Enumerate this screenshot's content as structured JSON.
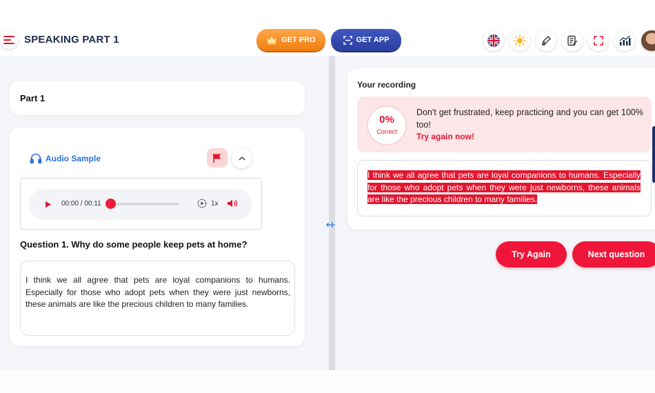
{
  "header": {
    "title": "SPEAKING PART 1",
    "get_pro_label": "GET PRO",
    "get_app_label": "GET APP",
    "tools": [
      "uk-flag-icon",
      "sun-icon",
      "pencil-icon",
      "notes-icon",
      "fullscreen-icon",
      "stats-icon"
    ]
  },
  "left": {
    "part_label": "Part 1",
    "audio_label": "Audio Sample",
    "player": {
      "time": "00:00 / 00:11",
      "speed": "1x",
      "progress": 0
    },
    "question": "Question 1. Why do some people keep pets at home?",
    "answer": "I think we all agree that pets are loyal companions to humans. Especially for those who adopt pets when they were just newborns, these animals are like the precious children to many families."
  },
  "right": {
    "recording_title": "Your recording",
    "score_value": "0%",
    "score_label": "Correct",
    "feedback_message": "Don't get frustrated, keep practicing and you can get 100% too!",
    "feedback_cta": "Try again now!",
    "transcript": "I think we all agree that pets are loyal companions to humans. Especially for those who adopt pets when they were just newborns, these animals are like the precious children to many families.",
    "try_again_label": "Try Again",
    "next_question_label": "Next question"
  },
  "colors": {
    "accent_red": "#f0163a",
    "brand_navy": "#1d2a4d",
    "audio_blue": "#2a71d8",
    "pro_orange": "#f07d0e",
    "app_blue": "#2b3f9e"
  }
}
